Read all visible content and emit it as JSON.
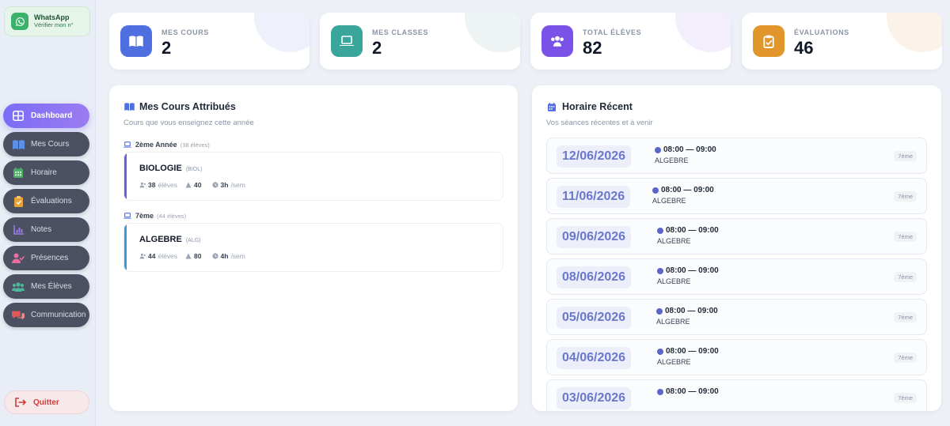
{
  "sidebar": {
    "whatsapp": {
      "title": "WhatsApp",
      "subtitle": "Vérifier mon n°"
    },
    "items": [
      {
        "label": "Dashboard",
        "icon": "grid-icon",
        "active": true
      },
      {
        "label": "Mes Cours",
        "icon": "book-icon"
      },
      {
        "label": "Horaire",
        "icon": "calendar-icon"
      },
      {
        "label": "Évaluations",
        "icon": "clipboard-icon"
      },
      {
        "label": "Notes",
        "icon": "chart-icon"
      },
      {
        "label": "Présences",
        "icon": "user-check-icon"
      },
      {
        "label": "Mes Élèves",
        "icon": "users-icon"
      },
      {
        "label": "Communication",
        "icon": "chat-icon"
      }
    ],
    "quit_label": "Quitter"
  },
  "stats": [
    {
      "label": "MES COURS",
      "value": "2",
      "color": "#4f6fe0"
    },
    {
      "label": "MES CLASSES",
      "value": "2",
      "color": "#3aa59a"
    },
    {
      "label": "TOTAL ÉLÈVES",
      "value": "82",
      "color": "#7b52e8"
    },
    {
      "label": "ÉVALUATIONS",
      "value": "46",
      "color": "#e0962a"
    }
  ],
  "courses_panel": {
    "title": "Mes Cours Attribués",
    "subtitle": "Cours que vous enseignez cette année",
    "groups": [
      {
        "name": "2ème Année",
        "count": "(38 élèves)",
        "course": {
          "name": "BIOLOGIE",
          "code": "(BIOL)",
          "students": "38",
          "students_label": "élèves",
          "evals": "40",
          "hours": "3h",
          "hours_label": "/sem",
          "accent": "#6b5fd6"
        }
      },
      {
        "name": "7ème",
        "count": "(44 élèves)",
        "course": {
          "name": "ALGEBRE",
          "code": "(ALG)",
          "students": "44",
          "students_label": "élèves",
          "evals": "80",
          "hours": "4h",
          "hours_label": "/sem",
          "accent": "#3b9bd9"
        }
      }
    ]
  },
  "schedule_panel": {
    "title": "Horaire Récent",
    "subtitle": "Vos séances récentes et à venir",
    "entries": [
      {
        "date": "12/06/2026",
        "time": "08:00 — 09:00",
        "subject": "ALGEBRE",
        "level": "7ème"
      },
      {
        "date": "11/06/2026",
        "time": "08:00 — 09:00",
        "subject": "ALGEBRE",
        "level": "7ème"
      },
      {
        "date": "09/06/2026",
        "time": "08:00 — 09:00",
        "subject": "ALGEBRE",
        "level": "7ème"
      },
      {
        "date": "08/06/2026",
        "time": "08:00 — 09:00",
        "subject": "ALGEBRE",
        "level": "7ème"
      },
      {
        "date": "05/06/2026",
        "time": "08:00 — 09:00",
        "subject": "ALGEBRE",
        "level": "7ème"
      },
      {
        "date": "04/06/2026",
        "time": "08:00 — 09:00",
        "subject": "ALGEBRE",
        "level": "7ème"
      },
      {
        "date": "03/06/2026",
        "time": "08:00 — 09:00",
        "subject": "",
        "level": "7ème"
      }
    ]
  }
}
